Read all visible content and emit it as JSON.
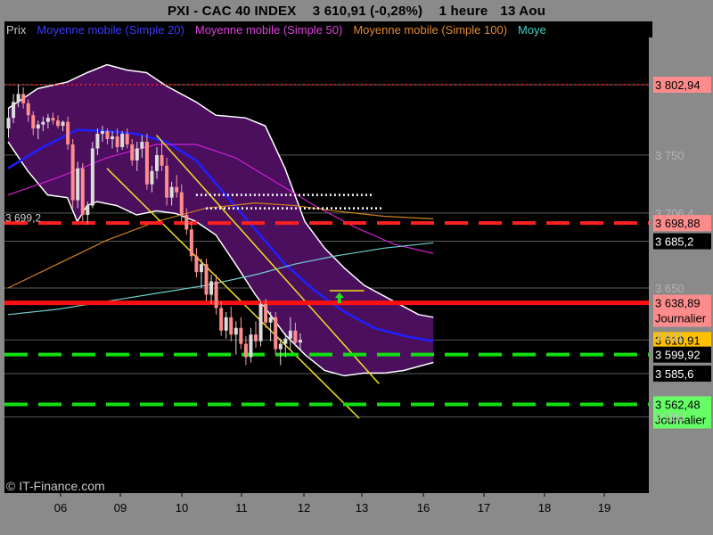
{
  "header": {
    "symbol": "PXI - CAC 40 INDEX",
    "price": "3 610,91 (-0,28%)",
    "period": "1 heure",
    "date": "13 Aou"
  },
  "legend": [
    {
      "label": "Prix",
      "color": "#c8c8c8"
    },
    {
      "label": "Moyenne mobile (Simple 20)",
      "color": "#3a3aff"
    },
    {
      "label": "Moyenne mobile (Simple 50)",
      "color": "#e040e0"
    },
    {
      "label": "Moyenne mobile (Simple 100)",
      "color": "#e08a30"
    },
    {
      "label": "Moye",
      "color": "#40d0c8"
    }
  ],
  "copyright": "© IT-Finance.com",
  "colors": {
    "background": "#000000",
    "frame": "#8a8a8a",
    "band_fill": "#4b0f5e",
    "band_line": "#ffffff",
    "ma20": "#2020ff",
    "ma50": "#d020d0",
    "ma100": "#d08020",
    "ma200": "#70d0d0",
    "candle_up": "#dcdcdc",
    "candle_down": "#ff8c8c",
    "trendline": "#f0e020",
    "resistance": "#ff1010",
    "support": "#10e010"
  },
  "price_labels": [
    {
      "text": "3 802,94",
      "value": 3802.94,
      "bg": "#ff8c8c",
      "fg": "#000000"
    },
    {
      "text": "3 750",
      "value": 3750,
      "bg": "",
      "fg": "#b4b4b4"
    },
    {
      "text": "3 706,4",
      "value": 3706.4,
      "bg": "",
      "fg": "#b4b4b4"
    },
    {
      "text": "3 698,88",
      "value": 3698.88,
      "bg": "#ff8c8c",
      "fg": "#000000"
    },
    {
      "text": "3 685,2",
      "value": 3685.2,
      "bg": "#000000",
      "fg": "#ffffff"
    },
    {
      "text": "3 638,89",
      "value": 3638.89,
      "bg": "#ff8c8c",
      "fg": "#000000",
      "sub": "Journalier"
    },
    {
      "text": "3 610,91",
      "value": 3610.91,
      "bg": "#ffc000",
      "fg": "#000000"
    },
    {
      "text": "3 599,92",
      "value": 3599.92,
      "bg": "#000000",
      "fg": "#ffffff"
    },
    {
      "text": "3 585,6",
      "value": 3585.6,
      "bg": "#000000",
      "fg": "#ffffff"
    },
    {
      "text": "3 562,48",
      "value": 3562.48,
      "bg": "#66ff66",
      "fg": "#000000",
      "sub": "Journalier"
    }
  ],
  "chart_data": {
    "type": "candlestick",
    "timeframe": "1 heure",
    "x_labels": [
      "06",
      "09",
      "10",
      "11",
      "12",
      "13",
      "16",
      "17",
      "18",
      "19"
    ],
    "yticks": [
      3750,
      3650
    ],
    "ylim": [
      3550,
      3830
    ],
    "left_label": "3 699,2",
    "candles": [
      [
        3770,
        3785,
        3763,
        3778
      ],
      [
        3778,
        3796,
        3774,
        3790
      ],
      [
        3790,
        3803,
        3786,
        3796
      ],
      [
        3796,
        3801,
        3785,
        3789
      ],
      [
        3789,
        3792,
        3775,
        3780
      ],
      [
        3780,
        3783,
        3765,
        3770
      ],
      [
        3770,
        3776,
        3762,
        3773
      ],
      [
        3773,
        3779,
        3768,
        3775
      ],
      [
        3775,
        3781,
        3770,
        3778
      ],
      [
        3778,
        3782,
        3773,
        3776
      ],
      [
        3776,
        3780,
        3770,
        3772
      ],
      [
        3772,
        3776,
        3768,
        3775
      ],
      [
        3775,
        3779,
        3754,
        3758
      ],
      [
        3758,
        3762,
        3710,
        3716
      ],
      [
        3716,
        3745,
        3710,
        3740
      ],
      [
        3740,
        3744,
        3700,
        3705
      ],
      [
        3705,
        3715,
        3698,
        3712
      ],
      [
        3712,
        3760,
        3710,
        3755
      ],
      [
        3755,
        3770,
        3750,
        3766
      ],
      [
        3766,
        3772,
        3760,
        3768
      ],
      [
        3768,
        3770,
        3758,
        3762
      ],
      [
        3762,
        3768,
        3755,
        3764
      ],
      [
        3764,
        3770,
        3752,
        3756
      ],
      [
        3756,
        3768,
        3754,
        3766
      ],
      [
        3766,
        3770,
        3755,
        3758
      ],
      [
        3758,
        3762,
        3742,
        3746
      ],
      [
        3746,
        3760,
        3738,
        3755
      ],
      [
        3755,
        3765,
        3748,
        3760
      ],
      [
        3760,
        3766,
        3724,
        3728
      ],
      [
        3728,
        3742,
        3722,
        3738
      ],
      [
        3738,
        3756,
        3732,
        3750
      ],
      [
        3750,
        3760,
        3738,
        3742
      ],
      [
        3742,
        3748,
        3712,
        3718
      ],
      [
        3718,
        3730,
        3712,
        3726
      ],
      [
        3726,
        3735,
        3718,
        3722
      ],
      [
        3722,
        3728,
        3700,
        3705
      ],
      [
        3705,
        3710,
        3690,
        3694
      ],
      [
        3694,
        3700,
        3670,
        3674
      ],
      [
        3674,
        3680,
        3658,
        3662
      ],
      [
        3662,
        3672,
        3650,
        3668
      ],
      [
        3668,
        3672,
        3640,
        3645
      ],
      [
        3645,
        3660,
        3638,
        3655
      ],
      [
        3655,
        3660,
        3630,
        3635
      ],
      [
        3635,
        3640,
        3614,
        3618
      ],
      [
        3618,
        3632,
        3612,
        3628
      ],
      [
        3628,
        3636,
        3610,
        3615
      ],
      [
        3615,
        3625,
        3600,
        3620
      ],
      [
        3620,
        3628,
        3604,
        3608
      ],
      [
        3608,
        3614,
        3592,
        3598
      ],
      [
        3598,
        3620,
        3594,
        3615
      ],
      [
        3615,
        3625,
        3605,
        3610
      ],
      [
        3610,
        3640,
        3606,
        3638
      ],
      [
        3638,
        3642,
        3620,
        3624
      ],
      [
        3624,
        3632,
        3610,
        3628
      ],
      [
        3628,
        3632,
        3600,
        3604
      ],
      [
        3604,
        3612,
        3592,
        3608
      ],
      [
        3608,
        3616,
        3598,
        3612
      ],
      [
        3612,
        3628,
        3604,
        3618
      ],
      [
        3618,
        3624,
        3606,
        3609
      ],
      [
        3609,
        3616,
        3604,
        3611
      ]
    ],
    "overlays": [
      {
        "name": "Moyenne mobile (Simple 20)",
        "color": "#2020ff",
        "values": [
          [
            0,
            3740
          ],
          [
            7,
            3756
          ],
          [
            14,
            3769
          ],
          [
            20,
            3768
          ],
          [
            26,
            3766
          ],
          [
            32,
            3760
          ],
          [
            38,
            3746
          ],
          [
            44,
            3720
          ],
          [
            50,
            3694
          ],
          [
            56,
            3668
          ],
          [
            62,
            3648
          ],
          [
            68,
            3632
          ],
          [
            74,
            3620
          ],
          [
            80,
            3614
          ],
          [
            86,
            3610
          ]
        ]
      },
      {
        "name": "Moyenne mobile (Simple 50)",
        "color": "#d020d0",
        "values": [
          [
            0,
            3720
          ],
          [
            10,
            3733
          ],
          [
            20,
            3748
          ],
          [
            30,
            3758
          ],
          [
            38,
            3758
          ],
          [
            46,
            3748
          ],
          [
            54,
            3730
          ],
          [
            62,
            3712
          ],
          [
            70,
            3696
          ],
          [
            78,
            3683
          ],
          [
            86,
            3676
          ]
        ]
      },
      {
        "name": "Moyenne mobile (Simple 100)",
        "color": "#d08020",
        "values": [
          [
            0,
            3650
          ],
          [
            10,
            3668
          ],
          [
            20,
            3686
          ],
          [
            30,
            3700
          ],
          [
            40,
            3710
          ],
          [
            50,
            3714
          ],
          [
            58,
            3712
          ],
          [
            66,
            3708
          ],
          [
            76,
            3704
          ],
          [
            86,
            3702
          ]
        ]
      },
      {
        "name": "Moye",
        "color": "#70d0d0",
        "values": [
          [
            0,
            3630
          ],
          [
            10,
            3634
          ],
          [
            20,
            3640
          ],
          [
            30,
            3646
          ],
          [
            40,
            3652
          ],
          [
            50,
            3660
          ],
          [
            58,
            3668
          ],
          [
            66,
            3674
          ],
          [
            76,
            3680
          ],
          [
            86,
            3684
          ]
        ]
      }
    ],
    "bands": {
      "upper": [
        [
          0,
          3785
        ],
        [
          6,
          3800
        ],
        [
          12,
          3805
        ],
        [
          16,
          3812
        ],
        [
          20,
          3818
        ],
        [
          24,
          3814
        ],
        [
          28,
          3812
        ],
        [
          32,
          3802
        ],
        [
          38,
          3790
        ],
        [
          42,
          3780
        ],
        [
          48,
          3778
        ],
        [
          52,
          3772
        ],
        [
          56,
          3740
        ],
        [
          60,
          3700
        ],
        [
          64,
          3680
        ],
        [
          68,
          3665
        ],
        [
          72,
          3652
        ],
        [
          78,
          3640
        ],
        [
          83,
          3630
        ],
        [
          86,
          3628
        ]
      ],
      "lower": [
        [
          0,
          3760
        ],
        [
          4,
          3738
        ],
        [
          8,
          3720
        ],
        [
          12,
          3718
        ],
        [
          14,
          3700
        ],
        [
          16,
          3712
        ],
        [
          18,
          3715
        ],
        [
          22,
          3712
        ],
        [
          26,
          3705
        ],
        [
          30,
          3708
        ],
        [
          34,
          3706
        ],
        [
          38,
          3700
        ],
        [
          42,
          3690
        ],
        [
          46,
          3668
        ],
        [
          50,
          3645
        ],
        [
          56,
          3615
        ],
        [
          60,
          3600
        ],
        [
          64,
          3588
        ],
        [
          68,
          3584
        ],
        [
          72,
          3586
        ],
        [
          76,
          3586
        ],
        [
          80,
          3588
        ],
        [
          84,
          3592
        ],
        [
          86,
          3594
        ]
      ]
    },
    "horizontal_lines": [
      {
        "value": 3802.94,
        "color": "#ff2020",
        "style": "dotted"
      },
      {
        "value": 3698.88,
        "color": "#ff2020",
        "style": "dashed"
      },
      {
        "value": 3638.89,
        "color": "#ff1010",
        "style": "solid"
      },
      {
        "value": 3599.92,
        "color": "#10e010",
        "style": "dashed"
      },
      {
        "value": 3562.48,
        "color": "#10e010",
        "style": "dashed"
      }
    ],
    "gray_lines": [
      3802.94,
      3750,
      3706.4,
      3685.2,
      3650,
      3610.91,
      3585.6,
      3553
    ],
    "trendlines": [
      {
        "from": [
          20,
          3740
        ],
        "to": [
          71,
          3552
        ],
        "color": "#f0e020"
      },
      {
        "from": [
          30,
          3765
        ],
        "to": [
          75,
          3578
        ],
        "color": "#f0e020"
      },
      {
        "from": [
          65,
          3648
        ],
        "to": [
          72,
          3648
        ],
        "color": "#f0e020"
      }
    ],
    "dotted_levels": [
      {
        "from": 38,
        "to": 74,
        "value": 3720,
        "color": "#ffffff"
      },
      {
        "from": 40,
        "to": 76,
        "value": 3710,
        "color": "#ffffff"
      }
    ],
    "arrow": {
      "x": 67,
      "value": 3642,
      "color": "#20e020"
    }
  }
}
